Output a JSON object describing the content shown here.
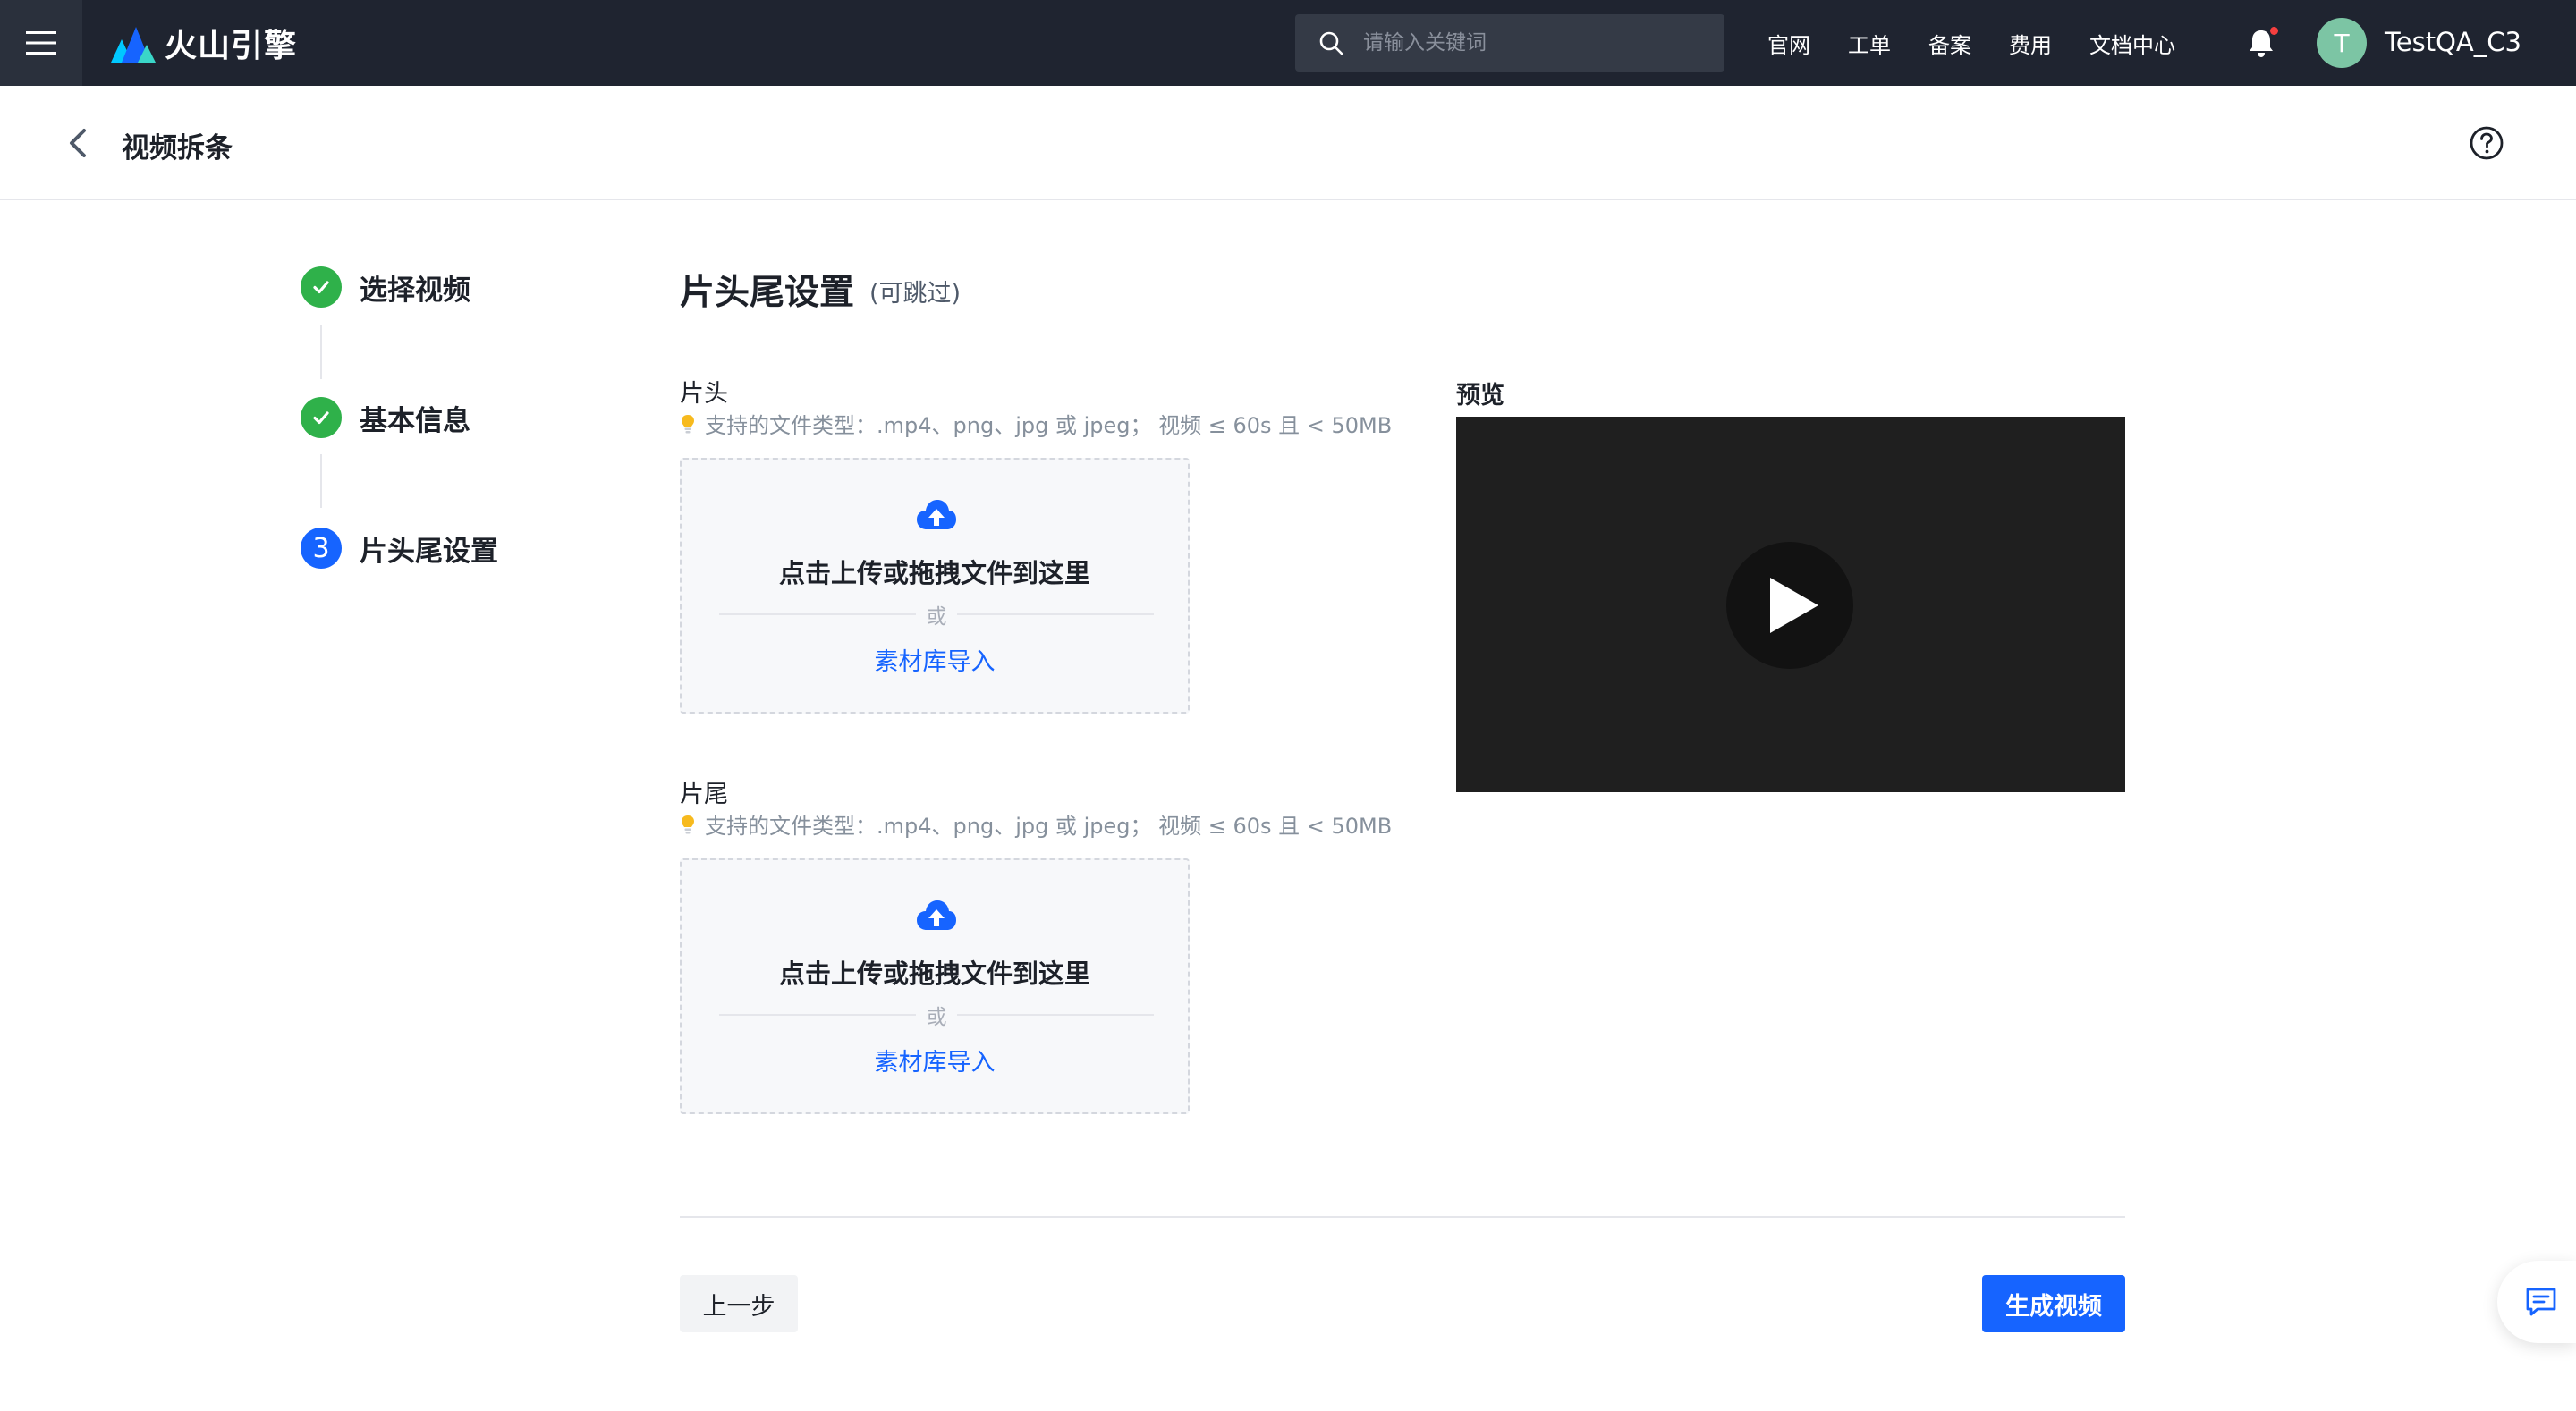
{
  "topbar": {
    "brand": "火山引擎",
    "search_placeholder": "请输入关键词",
    "nav": [
      "官网",
      "工单",
      "备案",
      "费用",
      "文档中心"
    ],
    "avatar_initial": "T",
    "username": "TestQA_C3",
    "notification_dot_color": "#f53f3f"
  },
  "page": {
    "title": "视频拆条"
  },
  "steps": [
    {
      "label": "选择视频",
      "status": "done"
    },
    {
      "label": "基本信息",
      "status": "done"
    },
    {
      "number": "3",
      "label": "片头尾设置",
      "status": "active"
    }
  ],
  "section": {
    "title": "片头尾设置",
    "subtitle": "(可跳过)"
  },
  "head": {
    "label": "片头",
    "hint": "支持的文件类型：.mp4、png、jpg 或 jpeg； 视频 ≤ 60s 且 < 50MB",
    "upload_text": "点击上传或拖拽文件到这里",
    "or": "或",
    "library_link": "素材库导入"
  },
  "tail": {
    "label": "片尾",
    "hint": "支持的文件类型：.mp4、png、jpg 或 jpeg； 视频 ≤ 60s 且 < 50MB",
    "upload_text": "点击上传或拖拽文件到这里",
    "or": "或",
    "library_link": "素材库导入"
  },
  "preview": {
    "label": "预览"
  },
  "footer": {
    "prev_label": "上一步",
    "generate_label": "生成视频"
  },
  "colors": {
    "primary": "#1664ff",
    "success": "#2fb14a",
    "topbar_bg": "#1f2430"
  },
  "icons": {
    "menu": "menu-icon",
    "search": "search-icon",
    "bell": "bell-icon",
    "back": "chevron-left-icon",
    "help": "help-circle-icon",
    "check": "check-icon",
    "upload": "cloud-upload-icon",
    "bulb": "lightbulb-icon",
    "play": "play-icon",
    "feedback": "feedback-icon"
  }
}
